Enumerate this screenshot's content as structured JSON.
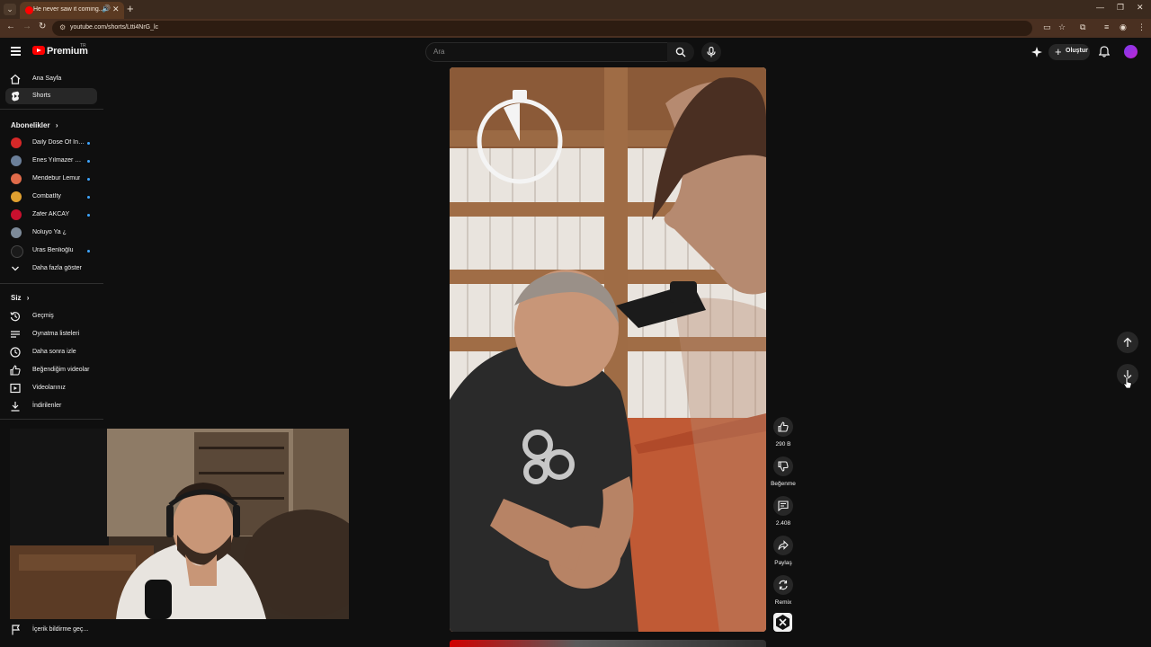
{
  "browser": {
    "tab_title": "He never saw it coming...",
    "tab_close": "✕",
    "new_tab": "+",
    "url": "youtube.com/shorts/Ltti4NrG_lc"
  },
  "header": {
    "logo_text": "Premium",
    "logo_country": "TR",
    "search_placeholder": "Ara",
    "create_label": "Oluştur"
  },
  "sidebar": {
    "main": [
      {
        "label": "Ana Sayfa",
        "icon": "home-icon"
      },
      {
        "label": "Shorts",
        "icon": "shorts-icon",
        "active": true
      }
    ],
    "subscriptions_title": "Abonelikler",
    "subscriptions": [
      {
        "label": "Daily Dose Of Int...",
        "color": "#d62828"
      },
      {
        "label": "Enes Yılmazer Tü...",
        "color": "#6b7f99"
      },
      {
        "label": "Mendebur Lemur",
        "color": "#e06b4a"
      },
      {
        "label": "CombatIty",
        "color": "#e0a030"
      },
      {
        "label": "Zafer AKCAY",
        "color": "#c8102e"
      },
      {
        "label": "Noluyo Ya ¿",
        "color": "#7d8a99"
      },
      {
        "label": "Uras Benlioğlu",
        "color": "#1a1a1a"
      }
    ],
    "show_more": "Daha fazla göster",
    "you_title": "Siz",
    "you_items": [
      {
        "label": "Geçmiş",
        "icon": "history-icon"
      },
      {
        "label": "Oynatma listeleri",
        "icon": "playlists-icon"
      },
      {
        "label": "Daha sonra izle",
        "icon": "watch-later-icon"
      },
      {
        "label": "Beğendiğim videolar",
        "icon": "liked-videos-icon"
      },
      {
        "label": "Videolarınız",
        "icon": "your-videos-icon"
      },
      {
        "label": "İndirilenler",
        "icon": "downloads-icon"
      }
    ],
    "report_label": "İçerik bildirme geç..."
  },
  "actions": {
    "likes": "290 B",
    "dislike": "Beğenme",
    "comments": "2.408",
    "share": "Paylaş",
    "remix": "Remix"
  },
  "colors": {
    "background": "#0f0f0f",
    "accent_red": "#ff0000",
    "browser_frame": "#3b2a1e"
  }
}
